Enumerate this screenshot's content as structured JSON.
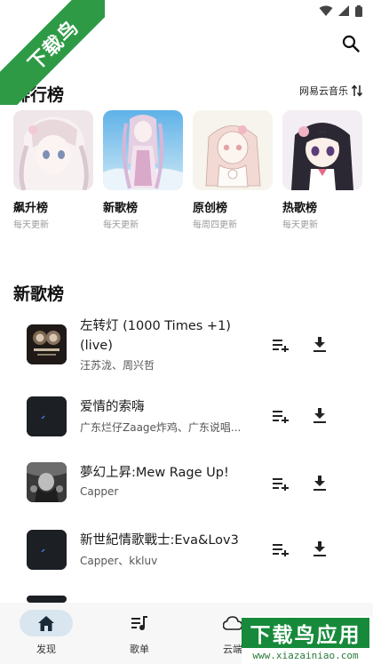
{
  "watermark": {
    "corner_text": "下载鸟",
    "brand_text": "下载鸟应用",
    "brand_url": "www.xiazainiao.com"
  },
  "header": {
    "search_icon": "search-icon"
  },
  "ranking": {
    "title": "排行榜",
    "source_label": "网易云音乐",
    "source_icon": "swap-vertical-icon",
    "charts": [
      {
        "name": "飙升榜",
        "update": "每天更新"
      },
      {
        "name": "新歌榜",
        "update": "每天更新"
      },
      {
        "name": "原创榜",
        "update": "每周四更新"
      },
      {
        "name": "热歌榜",
        "update": "每天更新"
      }
    ]
  },
  "new_songs": {
    "title": "新歌榜",
    "items": [
      {
        "title": "左转灯 (1000 Times +1) (live)",
        "artist": "汪苏泷、周兴哲"
      },
      {
        "title": "爱情的索嗨",
        "artist": "广东烂仔Zaage炸鸡、广东说唱..."
      },
      {
        "title": "夢幻上昇:Mew Rage Up!",
        "artist": "Capper"
      },
      {
        "title": "新世紀情歌戰士:Eva&Lov3",
        "artist": "Capper、kkluv"
      }
    ]
  },
  "bottom_nav": {
    "items": [
      {
        "label": "发现",
        "icon": "home-icon",
        "active": true
      },
      {
        "label": "歌单",
        "icon": "playlist-icon",
        "active": false
      },
      {
        "label": "云端",
        "icon": "cloud-icon",
        "active": false
      }
    ]
  },
  "colors": {
    "accent": "#d9e6ef",
    "watermark_green": "#2e9a45",
    "text_primary": "#111111",
    "text_secondary": "#9a9a9a"
  }
}
